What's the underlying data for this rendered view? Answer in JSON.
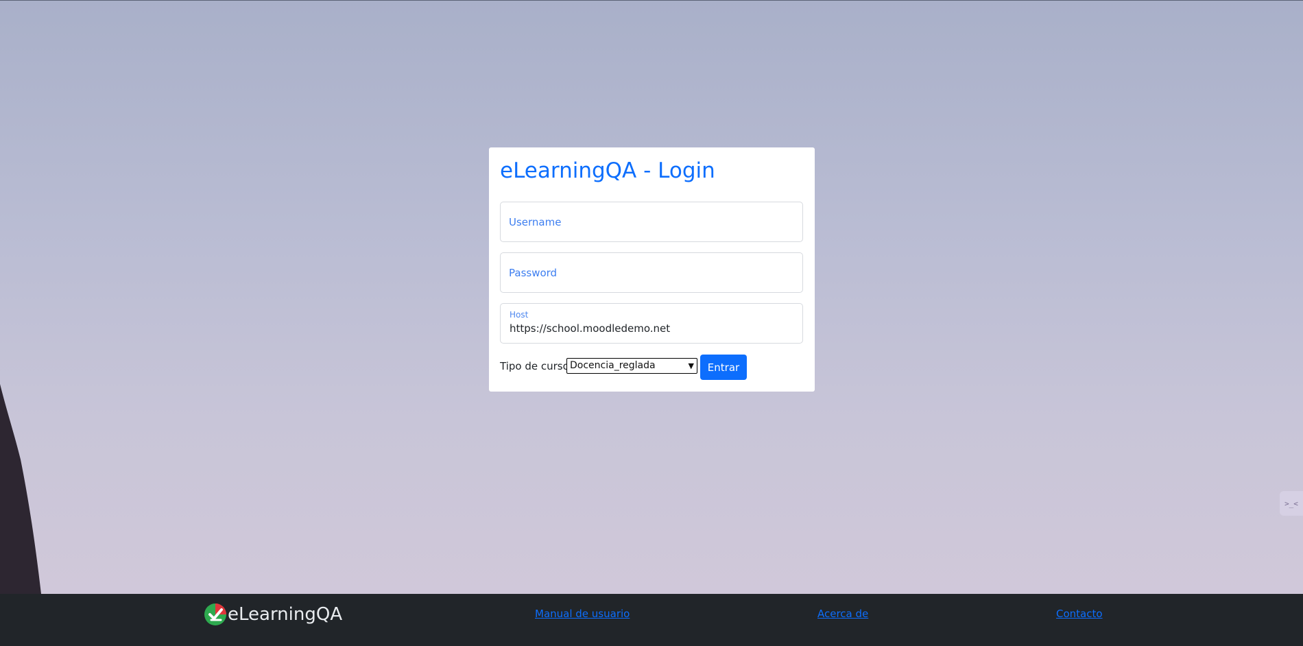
{
  "login": {
    "title": "eLearningQA - Login",
    "username_placeholder": "Username",
    "password_placeholder": "Password",
    "host_label": "Host",
    "host_value": "https://school.moodledemo.net",
    "course_type_label": "Tipo de curso:",
    "course_type_selected": "Docencia_reglada",
    "submit_label": "Entrar"
  },
  "footer": {
    "brand": "eLearningQA",
    "links": [
      "Manual de usuario",
      "Acerca de",
      "Contacto"
    ]
  },
  "colors": {
    "accent": "#0d6efd",
    "footer_bg": "#212529",
    "logo_green": "#2eaa4f",
    "logo_red": "#e0353b"
  },
  "icons": {
    "brand_logo": "elearningqa-logo-icon",
    "side_widget": "dev-tools-icon"
  }
}
